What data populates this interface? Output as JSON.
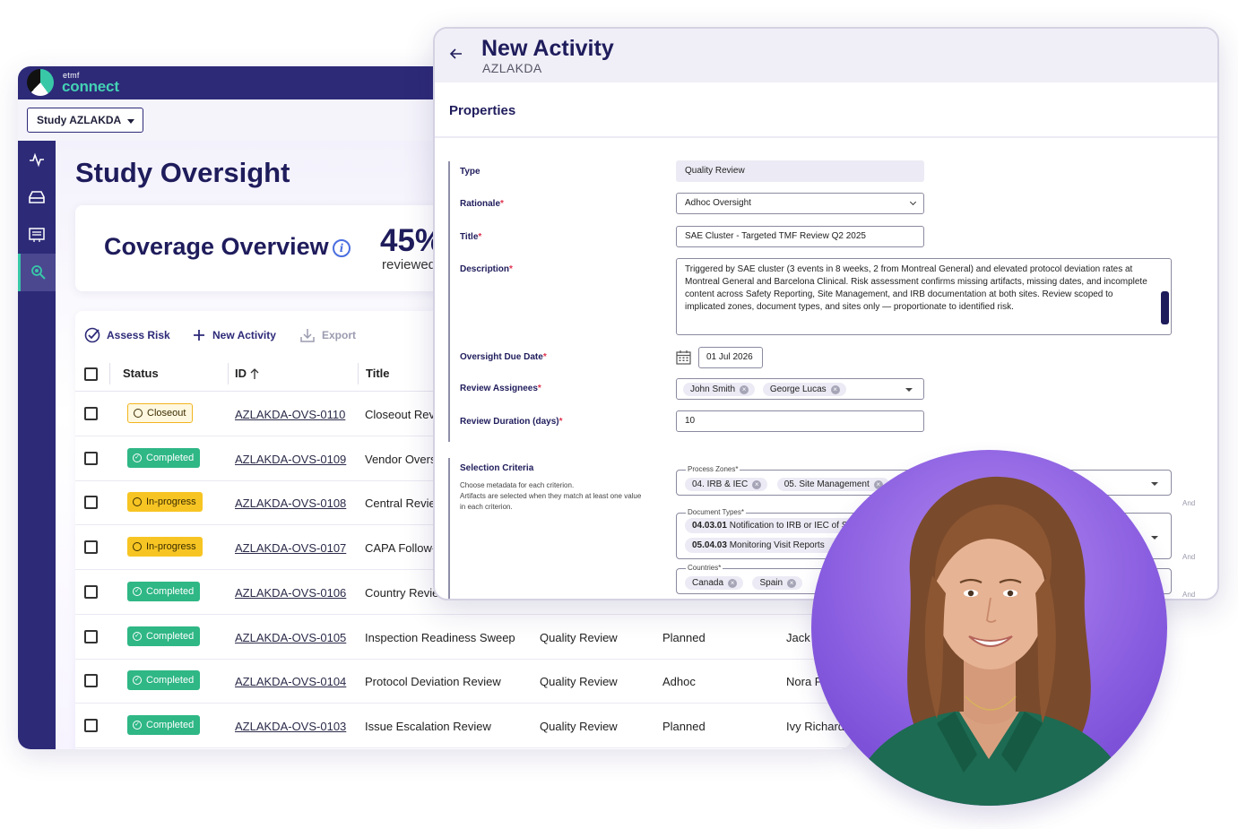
{
  "brand": {
    "small": "etmf",
    "big": "connect"
  },
  "study_selector": {
    "label": "Study AZLAKDA"
  },
  "sidebar": {
    "items": [
      {
        "icon": "activity-icon"
      },
      {
        "icon": "inbox-icon"
      },
      {
        "icon": "list-icon"
      },
      {
        "icon": "search-icon",
        "active": true
      }
    ]
  },
  "main": {
    "title": "Study Oversight",
    "coverage": {
      "title": "Coverage Overview",
      "percent": "45%",
      "sub": "reviewed"
    }
  },
  "toolbar": {
    "assess_risk": "Assess Risk",
    "new_activity": "New Activity",
    "export": "Export"
  },
  "table": {
    "headers": {
      "status": "Status",
      "id": "ID",
      "title": "Title"
    },
    "rows": [
      {
        "status": "Closeout",
        "status_type": "closeout",
        "id": "AZLAKDA-OVS-0110",
        "title": "Closeout Revi",
        "type": "",
        "rationale": "",
        "assignee": ""
      },
      {
        "status": "Completed",
        "status_type": "completed",
        "id": "AZLAKDA-OVS-0109",
        "title": "Vendor Overs",
        "type": "",
        "rationale": "",
        "assignee": ""
      },
      {
        "status": "In-progress",
        "status_type": "inprogress",
        "id": "AZLAKDA-OVS-0108",
        "title": "Central Revie",
        "type": "",
        "rationale": "",
        "assignee": ""
      },
      {
        "status": "In-progress",
        "status_type": "inprogress",
        "id": "AZLAKDA-OVS-0107",
        "title": "CAPA Follow-",
        "type": "",
        "rationale": "",
        "assignee": ""
      },
      {
        "status": "Completed",
        "status_type": "completed",
        "id": "AZLAKDA-OVS-0106",
        "title": "Country Revie",
        "type": "",
        "rationale": "",
        "assignee": ""
      },
      {
        "status": "Completed",
        "status_type": "completed",
        "id": "AZLAKDA-OVS-0105",
        "title": "Inspection Readiness Sweep",
        "type": "Quality Review",
        "rationale": "Planned",
        "assignee": "Jack"
      },
      {
        "status": "Completed",
        "status_type": "completed",
        "id": "AZLAKDA-OVS-0104",
        "title": "Protocol Deviation Review",
        "type": "Quality Review",
        "rationale": "Adhoc",
        "assignee": "Nora P"
      },
      {
        "status": "Completed",
        "status_type": "completed",
        "id": "AZLAKDA-OVS-0103",
        "title": "Issue Escalation Review",
        "type": "Quality Review",
        "rationale": "Planned",
        "assignee": "Ivy Richards"
      }
    ]
  },
  "modal": {
    "title": "New Activity",
    "subtitle": "AZLAKDA",
    "section": "Properties",
    "fields": {
      "type": {
        "label": "Type",
        "value": "Quality Review"
      },
      "rationale": {
        "label": "Rationale",
        "value": "Adhoc Oversight"
      },
      "title": {
        "label": "Title",
        "value": "SAE Cluster - Targeted TMF Review Q2 2025"
      },
      "description": {
        "label": "Description",
        "value": "Triggered by SAE cluster (3 events in 8 weeks, 2 from Montreal General) and elevated protocol deviation rates at Montreal General and Barcelona Clinical. Risk assessment confirms missing artifacts, missing dates, and incomplete content across Safety Reporting, Site Management, and IRB documentation at both sites. Review scoped to implicated zones, document types, and sites only — proportionate to identified risk."
      },
      "due_date": {
        "label": "Oversight Due Date",
        "value": "01 Jul 2026"
      },
      "assignees": {
        "label": "Review Assignees",
        "values": [
          "John Smith",
          "George Lucas"
        ]
      },
      "duration": {
        "label": "Review Duration (days)",
        "value": "10"
      }
    },
    "criteria": {
      "label": "Selection Criteria",
      "help1": "Choose metadata for each criterion.",
      "help2": "Artifacts are selected when they match at least one value in each criterion.",
      "process_zones": {
        "legend": "Process Zones*",
        "values": [
          "04. IRB & IEC",
          "05. Site Management"
        ]
      },
      "document_types": {
        "legend": "Document Types*",
        "values": [
          {
            "code": "04.03.01",
            "name": "Notification to IRB or IEC of S"
          },
          {
            "code": "05.04.03",
            "name": "Monitoring Visit Reports"
          }
        ]
      },
      "countries": {
        "legend": "Countries*",
        "values": [
          "Canada",
          "Spain"
        ]
      },
      "and_label": "And"
    }
  },
  "colors": {
    "brand_navy": "#2d2a78",
    "accent_teal": "#38c8a8",
    "completed": "#2fb786",
    "inprogress": "#f7c523",
    "required": "#e0334f"
  }
}
